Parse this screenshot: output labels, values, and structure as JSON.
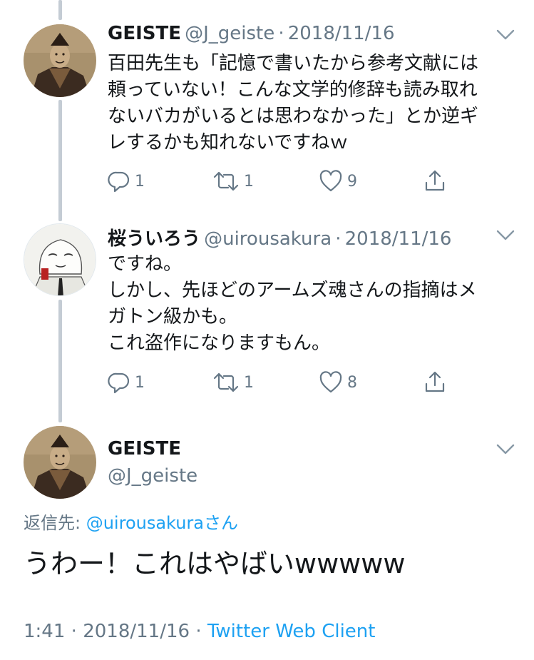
{
  "tweets": [
    {
      "name": "GEISTE",
      "handle": "@J_geiste",
      "date": "2018/11/16",
      "text": "百田先生も「記憶で書いたから参考文献には\n頼っていない！こんな文学的修辞も読み取れ\nないバカがいるとは思わなかった」とか逆ギ\nレするかも知れないですねｗ",
      "reply_count": "1",
      "retweet_count": "1",
      "like_count": "9"
    },
    {
      "name": "桜ういろう",
      "handle": "@uirousakura",
      "date": "2018/11/16",
      "text": "ですね。\nしかし、先ほどのアームズ魂さんの指摘はメ\nガトン級かも。\nこれ盗作になりますもん。",
      "reply_count": "1",
      "retweet_count": "1",
      "like_count": "8"
    }
  ],
  "main_tweet": {
    "name": "GEISTE",
    "handle": "@J_geiste",
    "reply_prefix": "返信先: ",
    "reply_to": "@uirousakura",
    "reply_suffix": "さん",
    "text": "うわー！これはやばいwwwww",
    "time": "1:41",
    "date": "2018/11/16",
    "client": "Twitter Web Client"
  },
  "colors": {
    "accent": "#1da1f2",
    "secondary": "#657786",
    "thread_line": "#c4ccd4"
  },
  "icons": [
    "reply-icon",
    "retweet-icon",
    "like-icon",
    "share-icon",
    "chevron-down-icon"
  ]
}
